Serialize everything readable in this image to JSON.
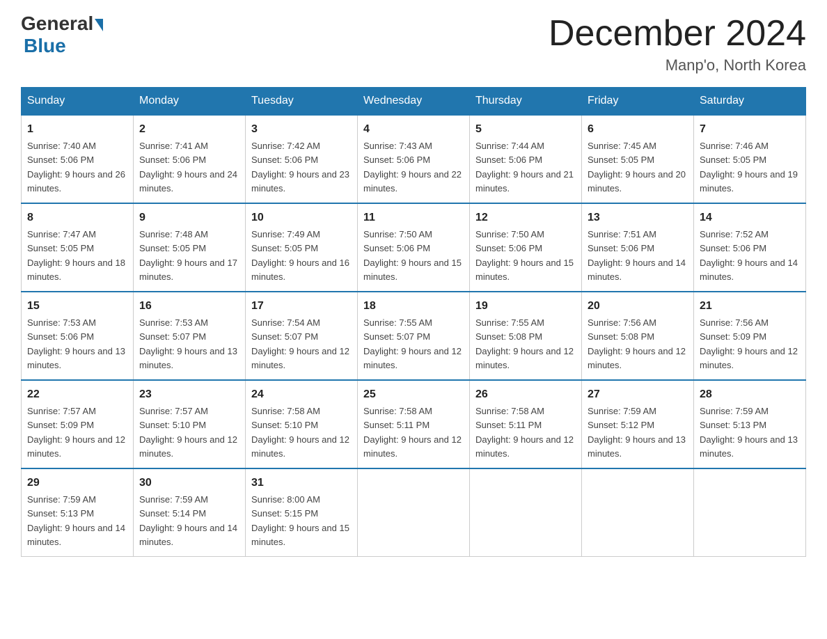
{
  "header": {
    "logo_general": "General",
    "logo_blue": "Blue",
    "title": "December 2024",
    "location": "Manp'o, North Korea"
  },
  "days_of_week": [
    "Sunday",
    "Monday",
    "Tuesday",
    "Wednesday",
    "Thursday",
    "Friday",
    "Saturday"
  ],
  "weeks": [
    [
      {
        "day": "1",
        "sunrise": "7:40 AM",
        "sunset": "5:06 PM",
        "daylight": "9 hours and 26 minutes."
      },
      {
        "day": "2",
        "sunrise": "7:41 AM",
        "sunset": "5:06 PM",
        "daylight": "9 hours and 24 minutes."
      },
      {
        "day": "3",
        "sunrise": "7:42 AM",
        "sunset": "5:06 PM",
        "daylight": "9 hours and 23 minutes."
      },
      {
        "day": "4",
        "sunrise": "7:43 AM",
        "sunset": "5:06 PM",
        "daylight": "9 hours and 22 minutes."
      },
      {
        "day": "5",
        "sunrise": "7:44 AM",
        "sunset": "5:06 PM",
        "daylight": "9 hours and 21 minutes."
      },
      {
        "day": "6",
        "sunrise": "7:45 AM",
        "sunset": "5:05 PM",
        "daylight": "9 hours and 20 minutes."
      },
      {
        "day": "7",
        "sunrise": "7:46 AM",
        "sunset": "5:05 PM",
        "daylight": "9 hours and 19 minutes."
      }
    ],
    [
      {
        "day": "8",
        "sunrise": "7:47 AM",
        "sunset": "5:05 PM",
        "daylight": "9 hours and 18 minutes."
      },
      {
        "day": "9",
        "sunrise": "7:48 AM",
        "sunset": "5:05 PM",
        "daylight": "9 hours and 17 minutes."
      },
      {
        "day": "10",
        "sunrise": "7:49 AM",
        "sunset": "5:05 PM",
        "daylight": "9 hours and 16 minutes."
      },
      {
        "day": "11",
        "sunrise": "7:50 AM",
        "sunset": "5:06 PM",
        "daylight": "9 hours and 15 minutes."
      },
      {
        "day": "12",
        "sunrise": "7:50 AM",
        "sunset": "5:06 PM",
        "daylight": "9 hours and 15 minutes."
      },
      {
        "day": "13",
        "sunrise": "7:51 AM",
        "sunset": "5:06 PM",
        "daylight": "9 hours and 14 minutes."
      },
      {
        "day": "14",
        "sunrise": "7:52 AM",
        "sunset": "5:06 PM",
        "daylight": "9 hours and 14 minutes."
      }
    ],
    [
      {
        "day": "15",
        "sunrise": "7:53 AM",
        "sunset": "5:06 PM",
        "daylight": "9 hours and 13 minutes."
      },
      {
        "day": "16",
        "sunrise": "7:53 AM",
        "sunset": "5:07 PM",
        "daylight": "9 hours and 13 minutes."
      },
      {
        "day": "17",
        "sunrise": "7:54 AM",
        "sunset": "5:07 PM",
        "daylight": "9 hours and 12 minutes."
      },
      {
        "day": "18",
        "sunrise": "7:55 AM",
        "sunset": "5:07 PM",
        "daylight": "9 hours and 12 minutes."
      },
      {
        "day": "19",
        "sunrise": "7:55 AM",
        "sunset": "5:08 PM",
        "daylight": "9 hours and 12 minutes."
      },
      {
        "day": "20",
        "sunrise": "7:56 AM",
        "sunset": "5:08 PM",
        "daylight": "9 hours and 12 minutes."
      },
      {
        "day": "21",
        "sunrise": "7:56 AM",
        "sunset": "5:09 PM",
        "daylight": "9 hours and 12 minutes."
      }
    ],
    [
      {
        "day": "22",
        "sunrise": "7:57 AM",
        "sunset": "5:09 PM",
        "daylight": "9 hours and 12 minutes."
      },
      {
        "day": "23",
        "sunrise": "7:57 AM",
        "sunset": "5:10 PM",
        "daylight": "9 hours and 12 minutes."
      },
      {
        "day": "24",
        "sunrise": "7:58 AM",
        "sunset": "5:10 PM",
        "daylight": "9 hours and 12 minutes."
      },
      {
        "day": "25",
        "sunrise": "7:58 AM",
        "sunset": "5:11 PM",
        "daylight": "9 hours and 12 minutes."
      },
      {
        "day": "26",
        "sunrise": "7:58 AM",
        "sunset": "5:11 PM",
        "daylight": "9 hours and 12 minutes."
      },
      {
        "day": "27",
        "sunrise": "7:59 AM",
        "sunset": "5:12 PM",
        "daylight": "9 hours and 13 minutes."
      },
      {
        "day": "28",
        "sunrise": "7:59 AM",
        "sunset": "5:13 PM",
        "daylight": "9 hours and 13 minutes."
      }
    ],
    [
      {
        "day": "29",
        "sunrise": "7:59 AM",
        "sunset": "5:13 PM",
        "daylight": "9 hours and 14 minutes."
      },
      {
        "day": "30",
        "sunrise": "7:59 AM",
        "sunset": "5:14 PM",
        "daylight": "9 hours and 14 minutes."
      },
      {
        "day": "31",
        "sunrise": "8:00 AM",
        "sunset": "5:15 PM",
        "daylight": "9 hours and 15 minutes."
      },
      null,
      null,
      null,
      null
    ]
  ]
}
